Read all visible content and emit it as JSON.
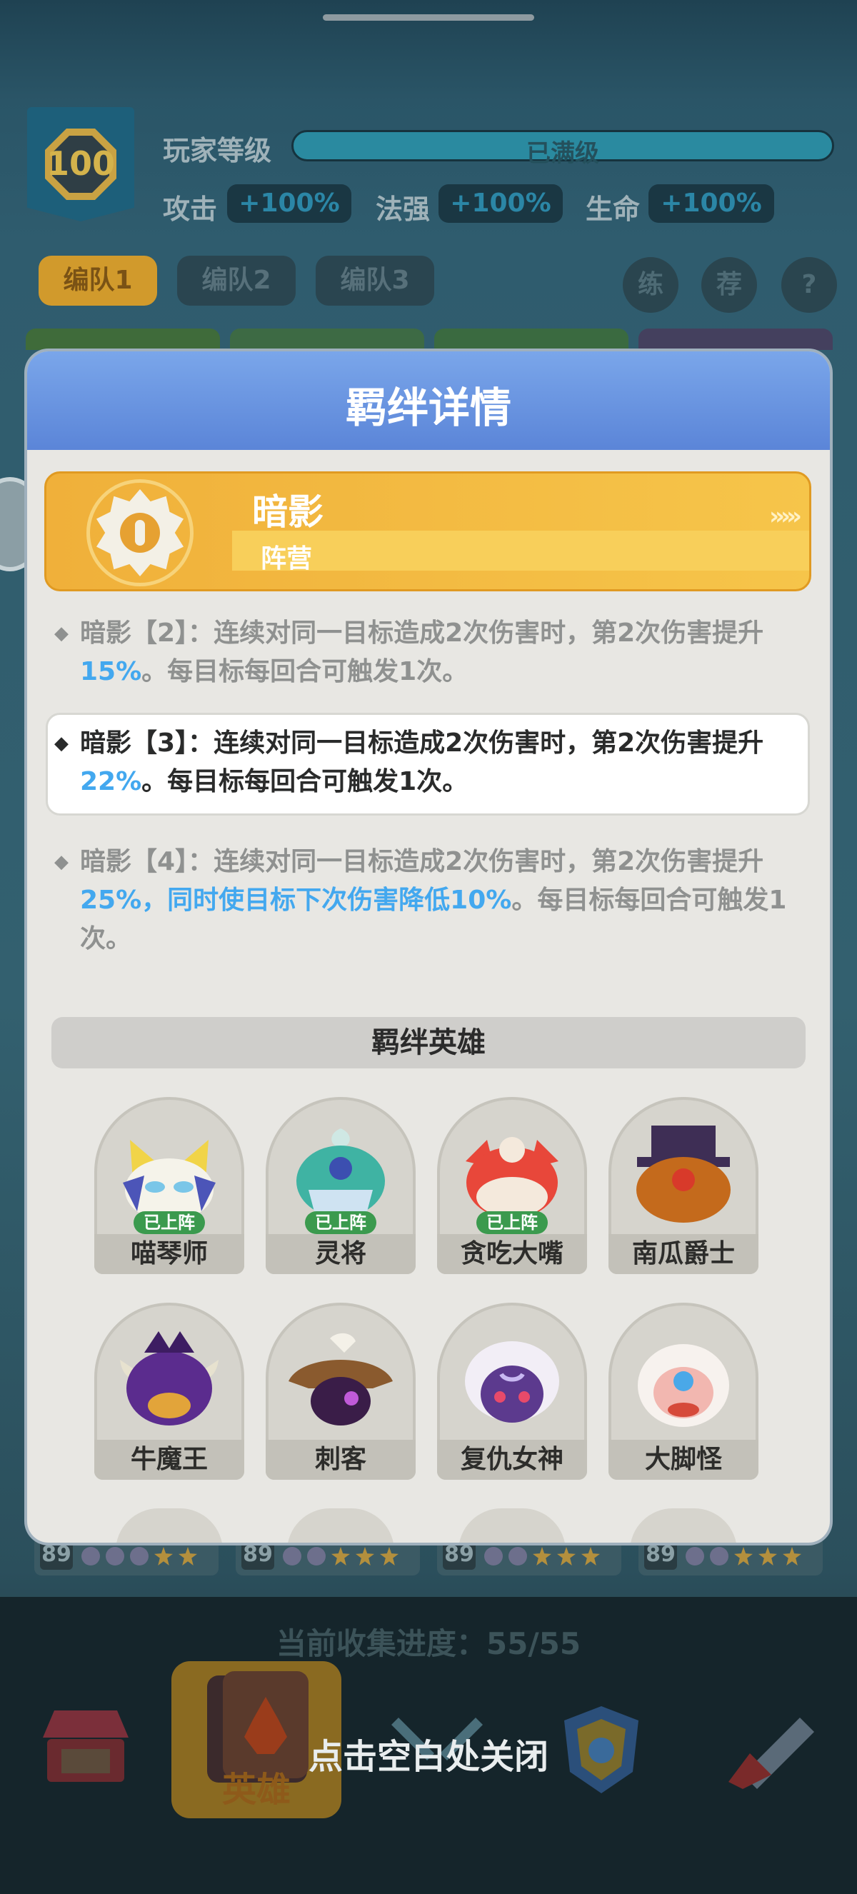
{
  "player": {
    "level": "100",
    "level_label": "玩家等级",
    "level_status": "已满级",
    "stats": [
      {
        "label": "攻击",
        "value": "+100%"
      },
      {
        "label": "法强",
        "value": "+100%"
      },
      {
        "label": "生命",
        "value": "+100%"
      }
    ]
  },
  "teams": [
    "编队1",
    "编队2",
    "编队3"
  ],
  "round_buttons": [
    "练",
    "荐",
    "?"
  ],
  "card_levels": [
    "89",
    "89",
    "89",
    "89"
  ],
  "collection_progress": "当前收集进度：55/55",
  "nav": {
    "hero_tab": "英雄"
  },
  "close_hint": "点击空白处关闭",
  "modal": {
    "title": "羁绊详情",
    "faction": {
      "name": "暗影",
      "type": "阵营"
    },
    "bonds": [
      {
        "label": "暗影【2】：",
        "pre": "连续对同一目标造成2次伤害时，第2次伤害提升",
        "hl": "15%",
        "post": "。每目标每回合可触发1次。"
      },
      {
        "label": "暗影【3】：",
        "pre": "连续对同一目标造成2次伤害时，第2次伤害提升",
        "hl": "22%",
        "post": "。每目标每回合可触发1次。"
      },
      {
        "label": "暗影【4】：",
        "pre": "连续对同一目标造成2次伤害时，第2次伤害提升",
        "hl": "25%，同时使目标下次伤害降低10%",
        "post": "。每目标每回合可触发1次。"
      }
    ],
    "heroes_title": "羁绊英雄",
    "deployed_label": "已上阵",
    "heroes": [
      "喵琴师",
      "灵将",
      "贪吃大嘴",
      "南瓜爵士",
      "牛魔王",
      "刺客",
      "复仇女神",
      "大脚怪"
    ]
  },
  "colors": {
    "header_blue": "#6a96e2",
    "faction_gold": "#f2b840",
    "highlight_blue": "#43a8ef",
    "deployed_green": "#3b9a4e"
  }
}
